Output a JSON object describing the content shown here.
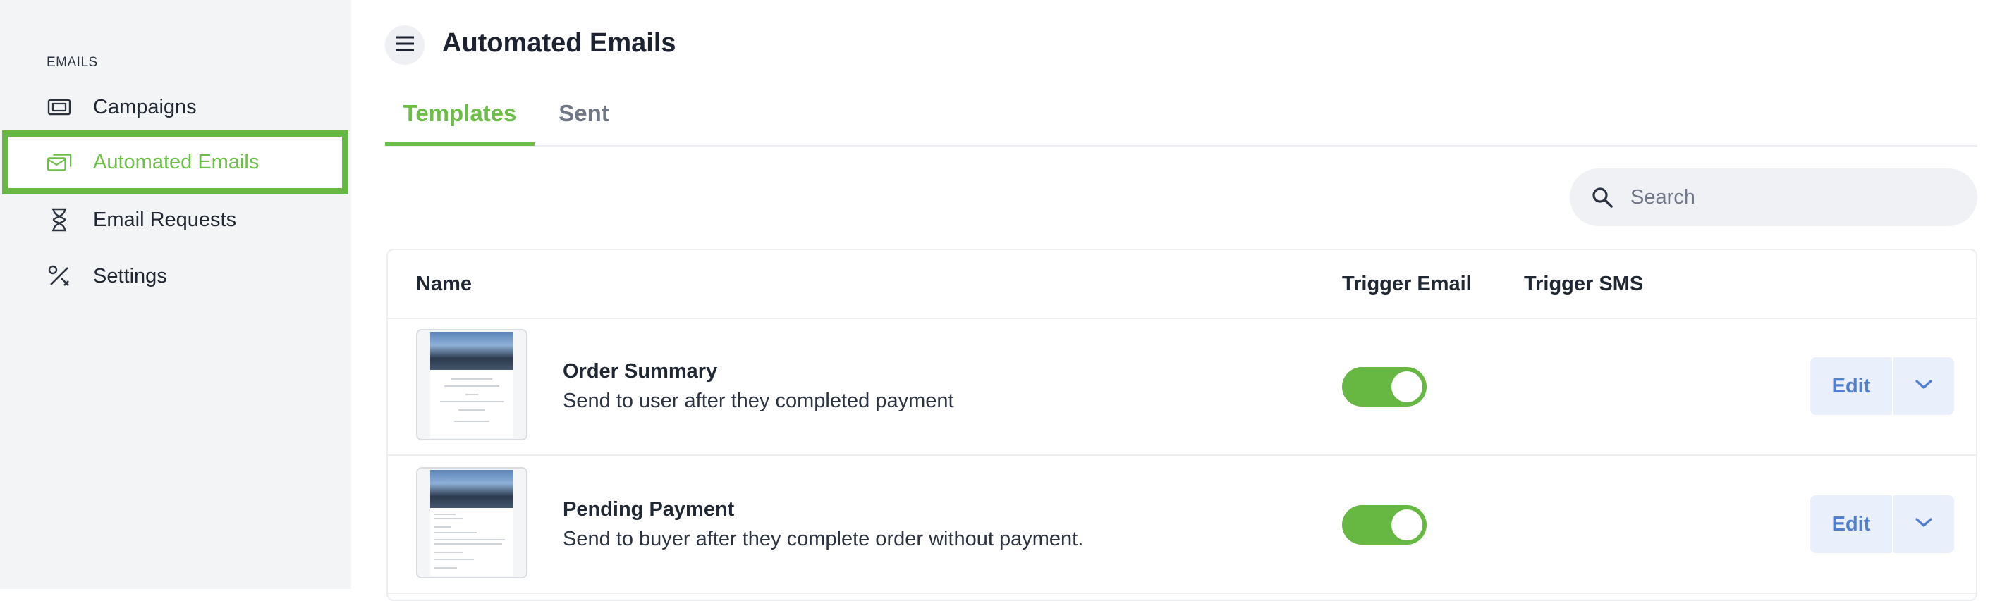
{
  "sidebar": {
    "section_label": "EMAILS",
    "items": [
      {
        "label": "Campaigns",
        "icon": "ticket-icon"
      },
      {
        "label": "Automated Emails",
        "icon": "mail-stack-icon",
        "active": true
      },
      {
        "label": "Email Requests",
        "icon": "hourglass-icon"
      },
      {
        "label": "Settings",
        "icon": "tools-icon"
      }
    ]
  },
  "header": {
    "title": "Automated Emails",
    "menu_icon": "hamburger-menu-icon"
  },
  "tabs": [
    {
      "label": "Templates",
      "active": true
    },
    {
      "label": "Sent",
      "active": false
    }
  ],
  "search": {
    "placeholder": "Search",
    "value": ""
  },
  "table": {
    "columns": [
      "Name",
      "Trigger Email",
      "Trigger SMS"
    ],
    "rows": [
      {
        "title": "Order Summary",
        "description": "Send to user after they completed payment",
        "trigger_email": true,
        "edit_label": "Edit"
      },
      {
        "title": "Pending Payment",
        "description": "Send to buyer after they complete order without payment.",
        "trigger_email": true,
        "edit_label": "Edit"
      }
    ]
  },
  "colors": {
    "accent": "#66b843",
    "sidebar_bg": "#f3f4f6",
    "edit_button_bg": "#e9f0fb",
    "edit_button_text": "#4f7fce"
  }
}
